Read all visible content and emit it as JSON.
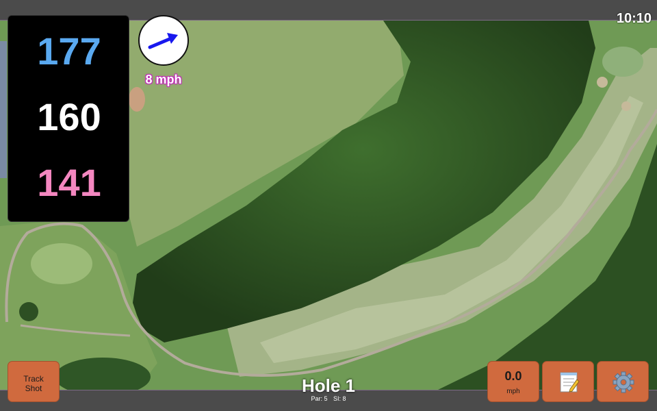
{
  "status": {
    "time": "10:10"
  },
  "distances": {
    "back": "177",
    "middle": "160",
    "front": "141"
  },
  "wind": {
    "speed_label": "8 mph",
    "direction_icon": "arrow-northeast-icon",
    "color": "#1818ee"
  },
  "hole": {
    "title": "Hole 1",
    "par_label": "Par: 5",
    "si_label": "SI: 8"
  },
  "buttons": {
    "track_shot_line1": "Track",
    "track_shot_line2": "Shot",
    "speed_value": "0.0",
    "speed_unit": "mph",
    "notes_icon": "notepad-icon",
    "settings_icon": "gear-icon"
  },
  "colors": {
    "back_distance": "#5aa9f0",
    "middle_distance": "#ffffff",
    "front_distance": "#f487c0",
    "button": "#d06a3e"
  }
}
